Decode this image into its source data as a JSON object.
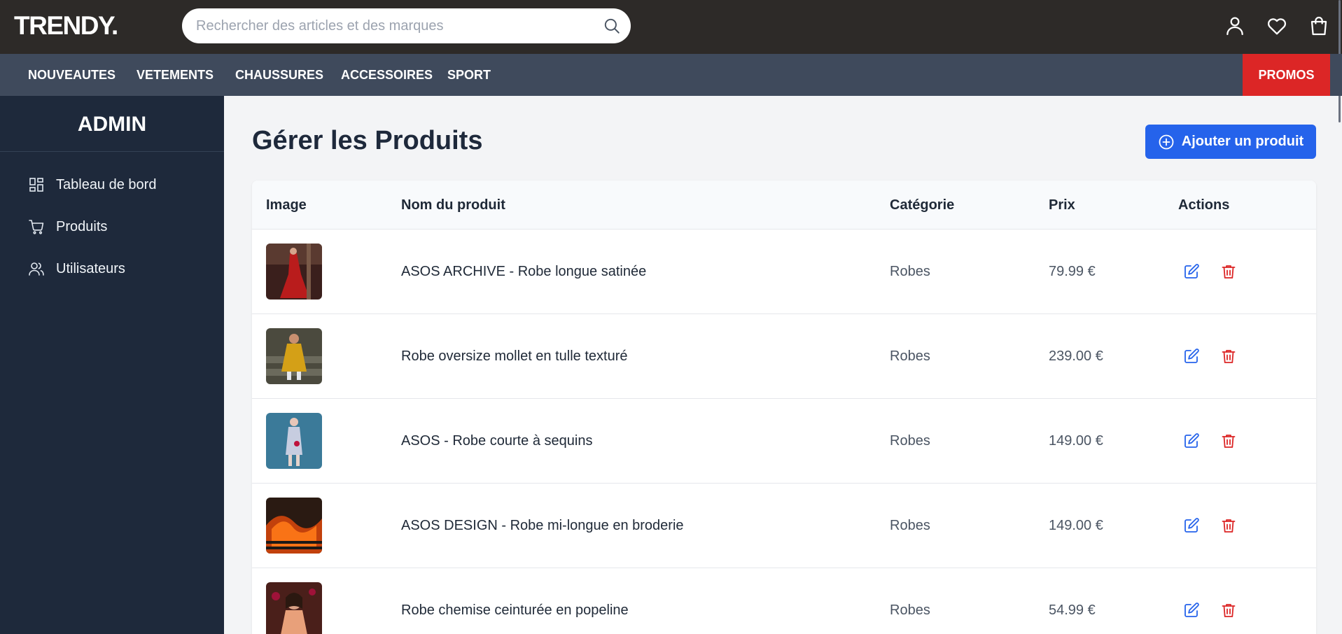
{
  "brand": {
    "logo": "TRENDY."
  },
  "search": {
    "placeholder": "Rechercher des articles et des marques"
  },
  "header_icons": [
    "user-icon",
    "heart-icon",
    "shopping-bag-icon"
  ],
  "category_nav": {
    "items": [
      "NOUVEAUTES",
      "VETEMENTS",
      "CHAUSSURES",
      "ACCESSOIRES",
      "SPORT"
    ],
    "promo": "PROMOS"
  },
  "sidebar": {
    "title": "ADMIN",
    "items": [
      {
        "label": "Tableau de bord",
        "icon": "dashboard-icon"
      },
      {
        "label": "Produits",
        "icon": "cart-icon"
      },
      {
        "label": "Utilisateurs",
        "icon": "users-icon"
      }
    ]
  },
  "main": {
    "title": "Gérer les Produits",
    "add_button": "Ajouter un produit"
  },
  "table": {
    "columns": [
      "Image",
      "Nom du produit",
      "Catégorie",
      "Prix",
      "Actions"
    ],
    "rows": [
      {
        "name": "ASOS ARCHIVE - Robe longue satinée",
        "category": "Robes",
        "price": "79.99 €"
      },
      {
        "name": "Robe oversize mollet en tulle texturé",
        "category": "Robes",
        "price": "239.00 €"
      },
      {
        "name": "ASOS - Robe courte à sequins",
        "category": "Robes",
        "price": "149.00 €"
      },
      {
        "name": "ASOS DESIGN - Robe mi-longue en broderie",
        "category": "Robes",
        "price": "149.00 €"
      },
      {
        "name": "Robe chemise ceinturée en popeline",
        "category": "Robes",
        "price": "54.99 €"
      }
    ]
  },
  "colors": {
    "topbar": "#2d2a28",
    "nav": "#3f4a5c",
    "sidebar": "#1e293b",
    "accent": "#2563eb",
    "promo": "#dc2626",
    "delete": "#dc2626"
  }
}
